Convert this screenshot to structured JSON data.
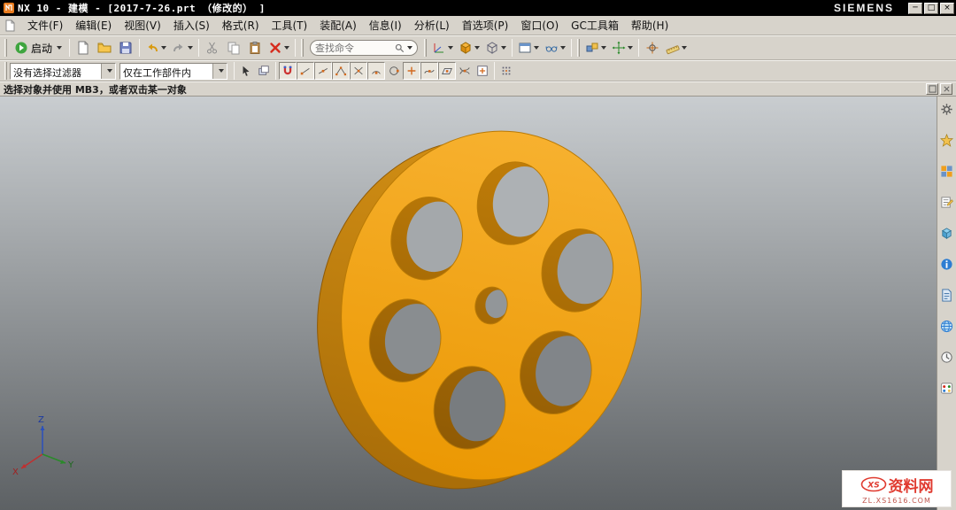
{
  "title_bar": {
    "app_title": "NX 10 - 建模 - [2017-7-26.prt （修改的） ]",
    "brand": "SIEMENS",
    "window_controls": {
      "minimize": "─",
      "maximize": "□",
      "close": "×"
    }
  },
  "menu_bar": {
    "items": [
      "文件(F)",
      "编辑(E)",
      "视图(V)",
      "插入(S)",
      "格式(R)",
      "工具(T)",
      "装配(A)",
      "信息(I)",
      "分析(L)",
      "首选项(P)",
      "窗口(O)",
      "GC工具箱",
      "帮助(H)"
    ]
  },
  "toolbar_main": {
    "start_button": "启动",
    "search_placeholder": "查找命令"
  },
  "selection_bar": {
    "filter_dropdown": "没有选择过滤器",
    "scope_dropdown": "仅在工作部件内"
  },
  "prompt_bar": {
    "message": "选择对象并使用 MB3，或者双击某一对象"
  },
  "viewport": {
    "triad": {
      "x_label": "X",
      "y_label": "Y",
      "z_label": "Z"
    }
  },
  "watermark": {
    "logo_text": "XS",
    "site_name": "资料网",
    "site_url": "ZL.XS1616.COM"
  },
  "colors": {
    "part_orange": "#F2A10B",
    "part_side": "#B4730A",
    "viewport_top": "#C9CDD0",
    "viewport_bottom": "#5D6164"
  }
}
